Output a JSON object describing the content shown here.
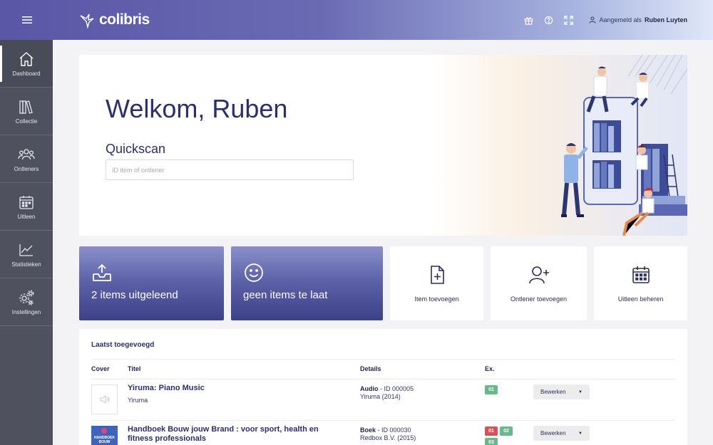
{
  "topbar": {
    "logo_text": "colibris",
    "user_prefix": "Aangemeld als",
    "user_name": "Ruben Luyten"
  },
  "sidebar": {
    "items": [
      {
        "label": "Dashboard",
        "icon": "home-icon"
      },
      {
        "label": "Collectie",
        "icon": "books-icon"
      },
      {
        "label": "Ontleners",
        "icon": "users-icon"
      },
      {
        "label": "Uitleen",
        "icon": "calendar-icon"
      },
      {
        "label": "Statistieken",
        "icon": "chart-icon"
      },
      {
        "label": "Instellingen",
        "icon": "gears-icon"
      }
    ]
  },
  "welcome": {
    "title": "Welkom, Ruben",
    "quickscan_label": "Quickscan",
    "quickscan_placeholder": "ID item of ontlener"
  },
  "tiles": {
    "loaned": "2 items uitgeleend",
    "late": "geen items te laat",
    "add_item": "Item toevoegen",
    "add_borrower": "Ontlener toevoegen",
    "manage_loans": "Uitleen beheren"
  },
  "recent": {
    "title": "Laatst toegevoegd",
    "columns": [
      "Cover",
      "Titel",
      "Details",
      "Ex."
    ],
    "rows": [
      {
        "title": "Yiruma: Piano Music",
        "subtitle": "Yiruma",
        "type": "Audio",
        "id": " - ID 000005",
        "publisher": "Yiruma (2014)",
        "copies": [
          "01"
        ],
        "action": "Bewerken"
      },
      {
        "title": "Handboek Bouw jouw Brand : voor sport, health en fitness professionals",
        "subtitle": "",
        "cover_text": "HANDBOEK BOUW",
        "type": "Boek",
        "id": " - ID 000030",
        "publisher": "Redbox B.V. (2015)",
        "copies": [
          "01",
          "02",
          "03"
        ],
        "action": "Bewerken"
      }
    ]
  },
  "colors": {
    "accent": "#2b2f6a",
    "sidebar": "#50515f",
    "badge_available": "#68b88a",
    "badge_loaned": "#d65353"
  }
}
